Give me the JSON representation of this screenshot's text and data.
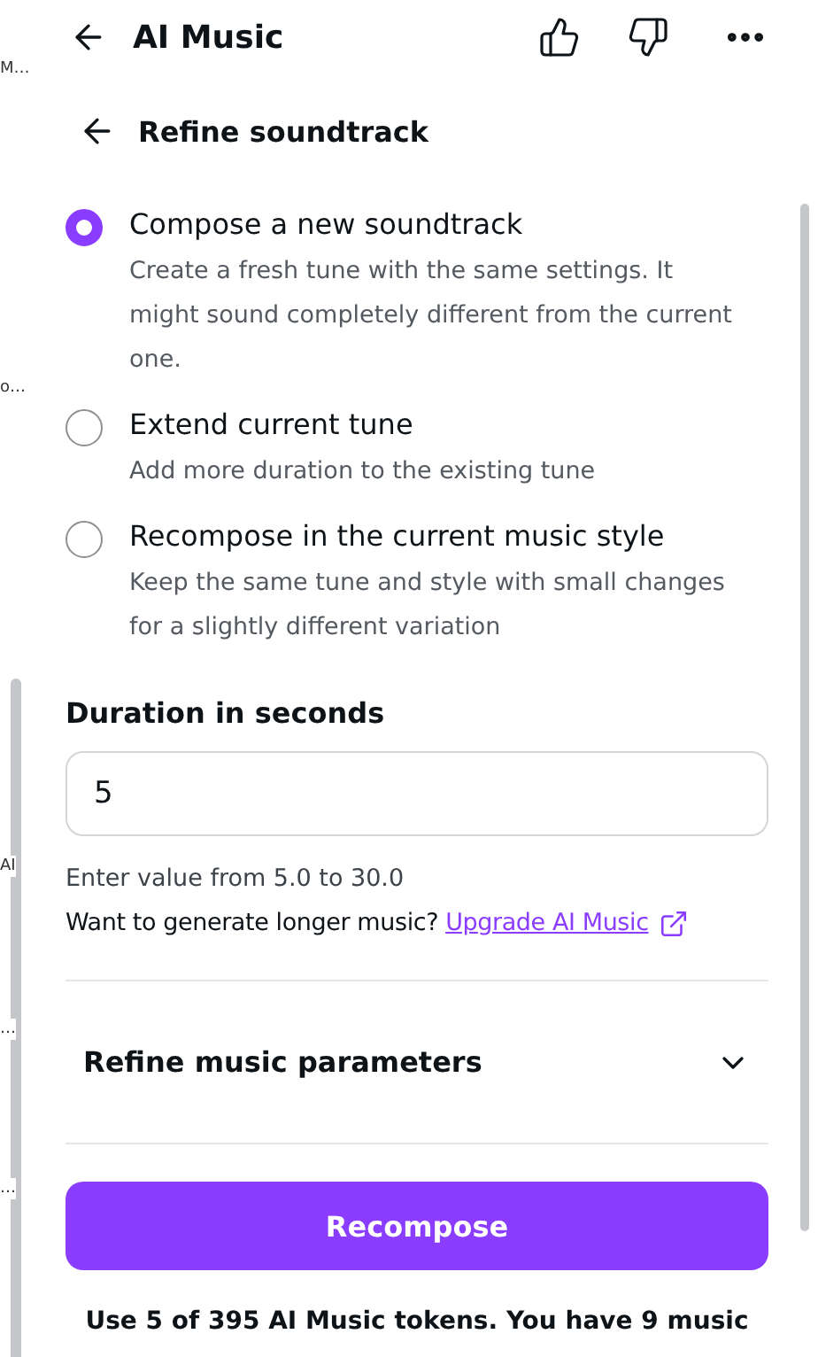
{
  "side_fragments": [
    "M…",
    "o…",
    "AI",
    "…",
    "…"
  ],
  "header": {
    "title": "AI Music"
  },
  "subheader": {
    "title": "Refine soundtrack"
  },
  "options": [
    {
      "label": "Compose a new soundtrack",
      "description": "Create a fresh tune with the same settings. It might sound completely different from the current one.",
      "selected": true
    },
    {
      "label": "Extend current tune",
      "description": "Add more duration to the existing tune",
      "selected": false
    },
    {
      "label": "Recompose in the current music style",
      "description": "Keep the same tune and style with small changes for a slightly different variation",
      "selected": false
    }
  ],
  "duration": {
    "label": "Duration in seconds",
    "value": "5",
    "hint": "Enter value from 5.0 to 30.0",
    "upgrade_text": "Want to generate longer music?",
    "upgrade_link": "Upgrade AI Music"
  },
  "accordion": {
    "label": "Refine music parameters",
    "expanded": false
  },
  "action_button": "Recompose",
  "footer_note": "Use 5 of 395 AI Music tokens. You have 9 music"
}
